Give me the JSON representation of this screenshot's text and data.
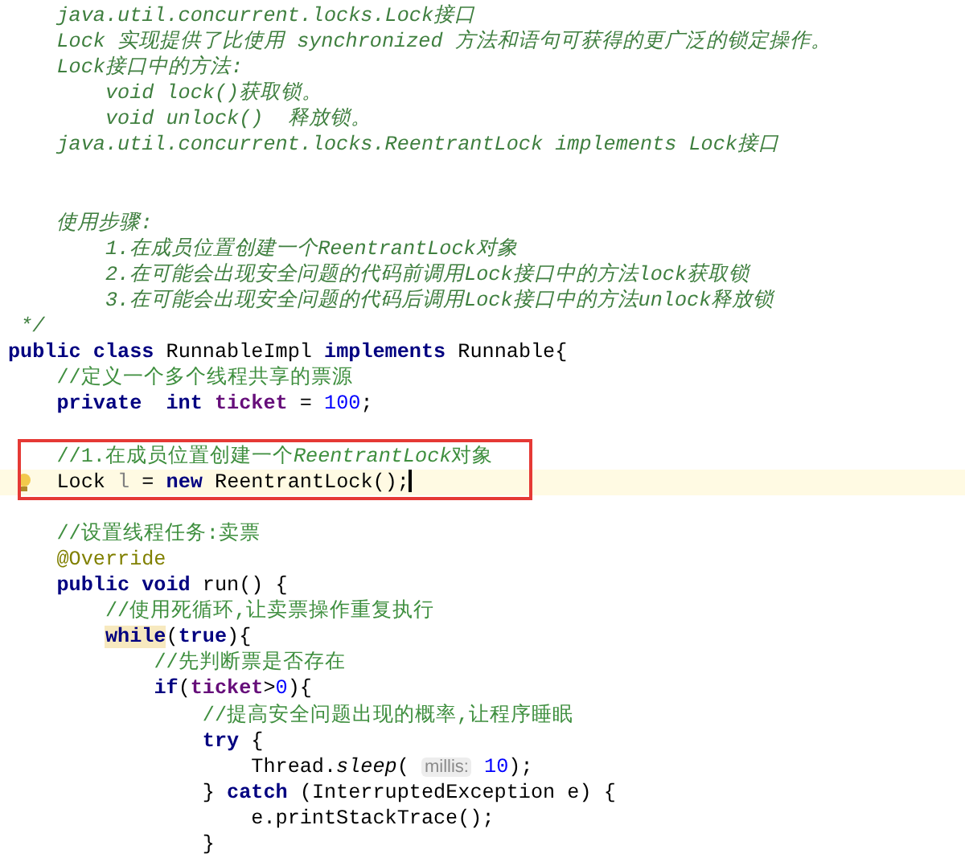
{
  "lines": [
    {
      "tokens": [
        {
          "kind": "doc",
          "text": "    java.util.concurrent.locks.Lock接口"
        }
      ]
    },
    {
      "tokens": [
        {
          "kind": "doc",
          "text": "    Lock 实现提供了比使用 synchronized 方法和语句可获得的更广泛的锁定操作。"
        }
      ]
    },
    {
      "tokens": [
        {
          "kind": "doc",
          "text": "    Lock接口中的方法:"
        }
      ]
    },
    {
      "tokens": [
        {
          "kind": "doc",
          "text": "        void lock()获取锁。"
        }
      ]
    },
    {
      "tokens": [
        {
          "kind": "doc",
          "text": "        void unlock()  释放锁。"
        }
      ]
    },
    {
      "tokens": [
        {
          "kind": "doc",
          "text": "    java.util.concurrent.locks.ReentrantLock implements Lock接口"
        }
      ]
    },
    {
      "kind": "blank"
    },
    {
      "kind": "blank"
    },
    {
      "tokens": [
        {
          "kind": "doc",
          "text": "    使用步骤:"
        }
      ]
    },
    {
      "tokens": [
        {
          "kind": "doc",
          "text": "        1.在成员位置创建一个ReentrantLock对象"
        }
      ]
    },
    {
      "tokens": [
        {
          "kind": "doc",
          "text": "        2.在可能会出现安全问题的代码前调用Lock接口中的方法lock获取锁"
        }
      ]
    },
    {
      "tokens": [
        {
          "kind": "doc",
          "text": "        3.在可能会出现安全问题的代码后调用Lock接口中的方法unlock释放锁"
        }
      ]
    },
    {
      "tokens": [
        {
          "kind": "doc",
          "text": " */"
        }
      ]
    },
    {
      "tokens": [
        {
          "kind": "keyword",
          "text": "public class"
        },
        {
          "kind": "plain",
          "text": " RunnableImpl "
        },
        {
          "kind": "keyword",
          "text": "implements"
        },
        {
          "kind": "plain",
          "text": " Runnable{"
        }
      ]
    },
    {
      "tokens": [
        {
          "kind": "comment",
          "text": "    //定义一个多个线程共享的票源"
        }
      ]
    },
    {
      "tokens": [
        {
          "kind": "keyword",
          "text": "    private  int"
        },
        {
          "kind": "field",
          "text": " ticket"
        },
        {
          "kind": "plain",
          "text": " = "
        },
        {
          "kind": "number",
          "text": "100"
        },
        {
          "kind": "plain",
          "text": ";"
        }
      ]
    },
    {
      "kind": "blank"
    },
    {
      "boxed": true,
      "tokens": [
        {
          "kind": "comment",
          "text": "    //1.在成员位置创建一个"
        },
        {
          "kind": "comment-italic",
          "text": "ReentrantLock"
        },
        {
          "kind": "comment",
          "text": "对象"
        }
      ]
    },
    {
      "boxed": true,
      "current": true,
      "cursor": true,
      "tokens": [
        {
          "kind": "plain",
          "text": "    Lock "
        },
        {
          "kind": "unused",
          "text": "l"
        },
        {
          "kind": "plain",
          "text": " = "
        },
        {
          "kind": "keyword",
          "text": "new"
        },
        {
          "kind": "plain",
          "text": " ReentrantLock();"
        }
      ]
    },
    {
      "kind": "blank"
    },
    {
      "tokens": [
        {
          "kind": "comment",
          "text": "    //设置线程任务:卖票"
        }
      ]
    },
    {
      "tokens": [
        {
          "kind": "annotation",
          "text": "    @Override"
        }
      ]
    },
    {
      "tokens": [
        {
          "kind": "keyword",
          "text": "    public void"
        },
        {
          "kind": "plain",
          "text": " run() {"
        }
      ]
    },
    {
      "tokens": [
        {
          "kind": "comment",
          "text": "        //使用死循环,让卖票操作重复执行"
        }
      ]
    },
    {
      "tokens": [
        {
          "kind": "keyword",
          "text": "        while",
          "matched": true
        },
        {
          "kind": "plain",
          "text": "("
        },
        {
          "kind": "keyword",
          "text": "true"
        },
        {
          "kind": "plain",
          "text": "){"
        }
      ]
    },
    {
      "tokens": [
        {
          "kind": "comment",
          "text": "            //先判断票是否存在"
        }
      ]
    },
    {
      "tokens": [
        {
          "kind": "keyword",
          "text": "            if"
        },
        {
          "kind": "plain",
          "text": "("
        },
        {
          "kind": "field",
          "text": "ticket"
        },
        {
          "kind": "plain",
          "text": ">"
        },
        {
          "kind": "number",
          "text": "0"
        },
        {
          "kind": "plain",
          "text": "){"
        }
      ]
    },
    {
      "tokens": [
        {
          "kind": "comment",
          "text": "                //提高安全问题出现的概率,让程序睡眠"
        }
      ]
    },
    {
      "tokens": [
        {
          "kind": "keyword",
          "text": "                try"
        },
        {
          "kind": "plain",
          "text": " {"
        }
      ]
    },
    {
      "tokens": [
        {
          "kind": "plain",
          "text": "                    Thread."
        },
        {
          "kind": "static",
          "text": "sleep"
        },
        {
          "kind": "plain",
          "text": "( "
        },
        {
          "kind": "hint",
          "text": "millis:"
        },
        {
          "kind": "number",
          "text": " 10"
        },
        {
          "kind": "plain",
          "text": ");"
        }
      ]
    },
    {
      "tokens": [
        {
          "kind": "plain",
          "text": "                } "
        },
        {
          "kind": "keyword",
          "text": "catch"
        },
        {
          "kind": "plain",
          "text": " (InterruptedException e) {"
        }
      ]
    },
    {
      "tokens": [
        {
          "kind": "plain",
          "text": "                    e.printStackTrace();"
        }
      ]
    },
    {
      "tokens": [
        {
          "kind": "plain",
          "text": "                }"
        }
      ]
    }
  ]
}
